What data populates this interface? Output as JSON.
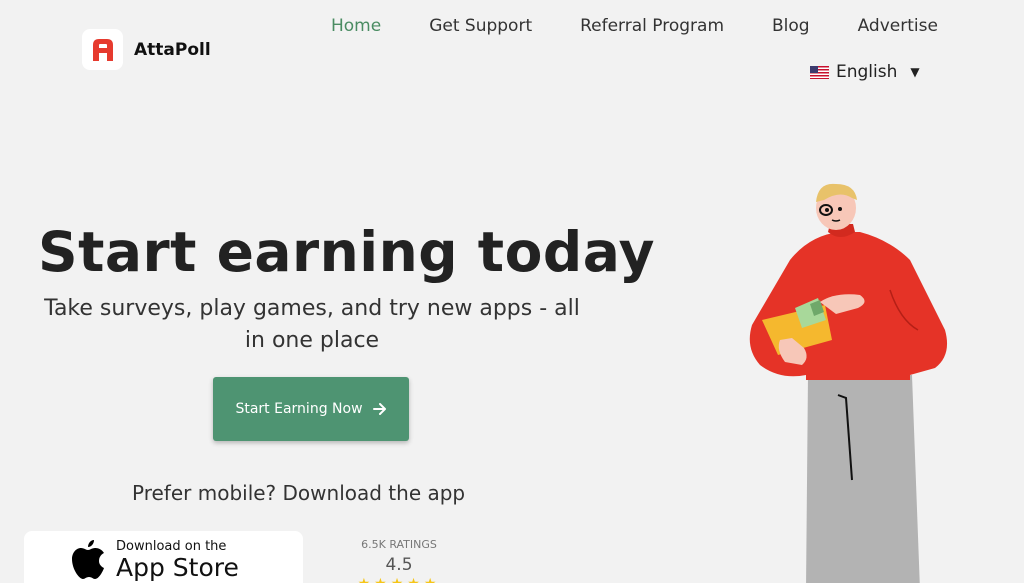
{
  "brand": {
    "name": "AttaPoll",
    "color": "#e63a2e"
  },
  "nav": {
    "items": [
      {
        "label": "Home",
        "active": true
      },
      {
        "label": "Get Support",
        "active": false
      },
      {
        "label": "Referral Program",
        "active": false
      },
      {
        "label": "Blog",
        "active": false
      },
      {
        "label": "Advertise",
        "active": false
      }
    ],
    "accent": "#4a8c62"
  },
  "language": {
    "selected": "English",
    "flag": "us-flag-icon"
  },
  "hero": {
    "title": "Start earning today",
    "subtitle": "Take surveys, play games, and try new apps - all in one place",
    "cta_label": "Start Earning Now",
    "cta_color": "#4e9472"
  },
  "mobile": {
    "prompt": "Prefer mobile? Download the app",
    "appstore_small": "Download on the",
    "appstore_big": "App Store",
    "ratings_count": "6.5K RATINGS",
    "rating_score": "4.5",
    "rating_stars": 4.5
  }
}
